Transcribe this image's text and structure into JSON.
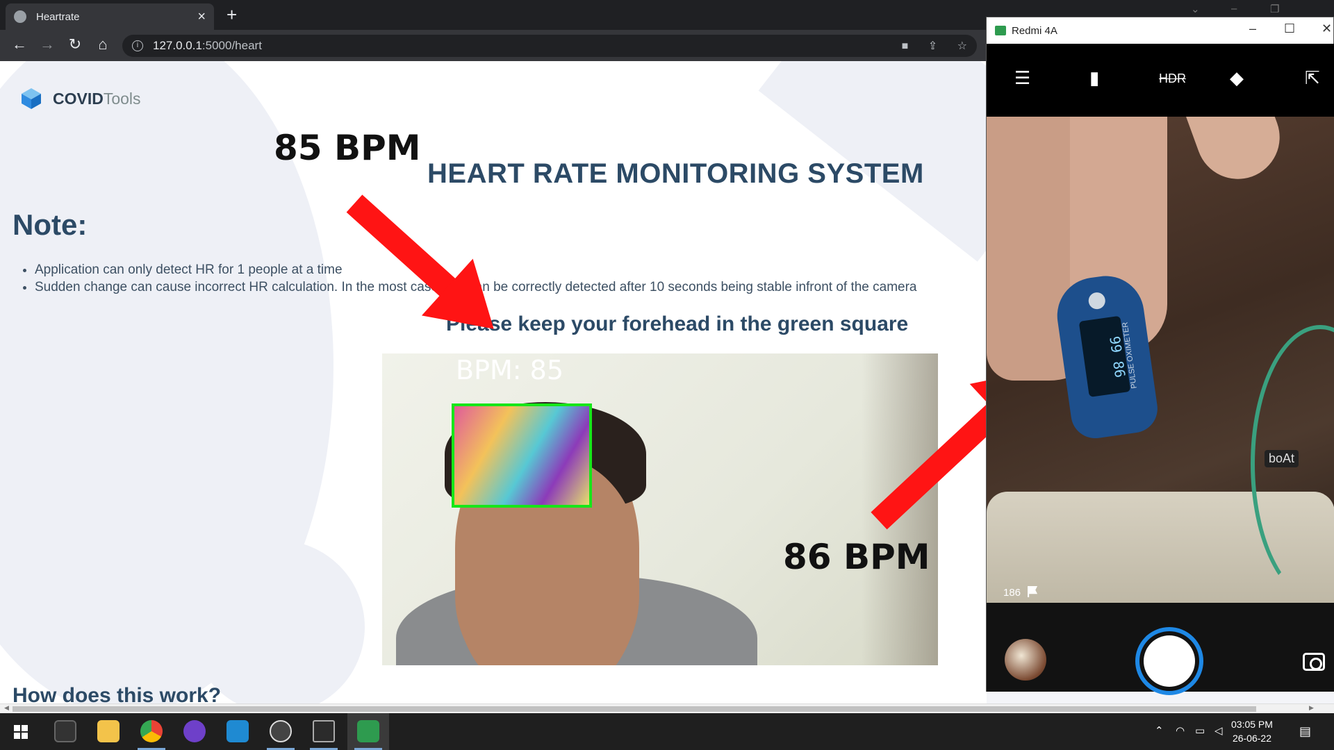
{
  "browser": {
    "tab_title": "Heartrate",
    "new_tab": "+",
    "url_host": "127.0.0.1",
    "url_path": ":5000/heart"
  },
  "page": {
    "logo_main": "COVID",
    "logo_accent": "Tools",
    "heading": "HEART RATE MONITORING SYSTEM",
    "note_title": "Note:",
    "notes": [
      "Application can only detect HR for 1 people at a time",
      "Sudden change can cause incorrect HR calculation. In the most case, HR can be correctly detected after 10 seconds being stable infront of the camera"
    ],
    "instruction": "Please keep your forehead in the green square",
    "section_next": "How does this work?",
    "video_bpm": "BPM:  85"
  },
  "annotations": {
    "app_bpm": "85 BPM",
    "oximeter_bpm": "86 BPM",
    "arrow_color": "#ff1414"
  },
  "phone_window": {
    "title": "Redmi 4A",
    "frame_count": "186",
    "oximeter_label": "PULSE OXIMETER",
    "oximeter_reading": "99 86",
    "brand_label": "boAt"
  },
  "taskbar": {
    "time": "03:05 PM",
    "date": "26-06-22"
  }
}
